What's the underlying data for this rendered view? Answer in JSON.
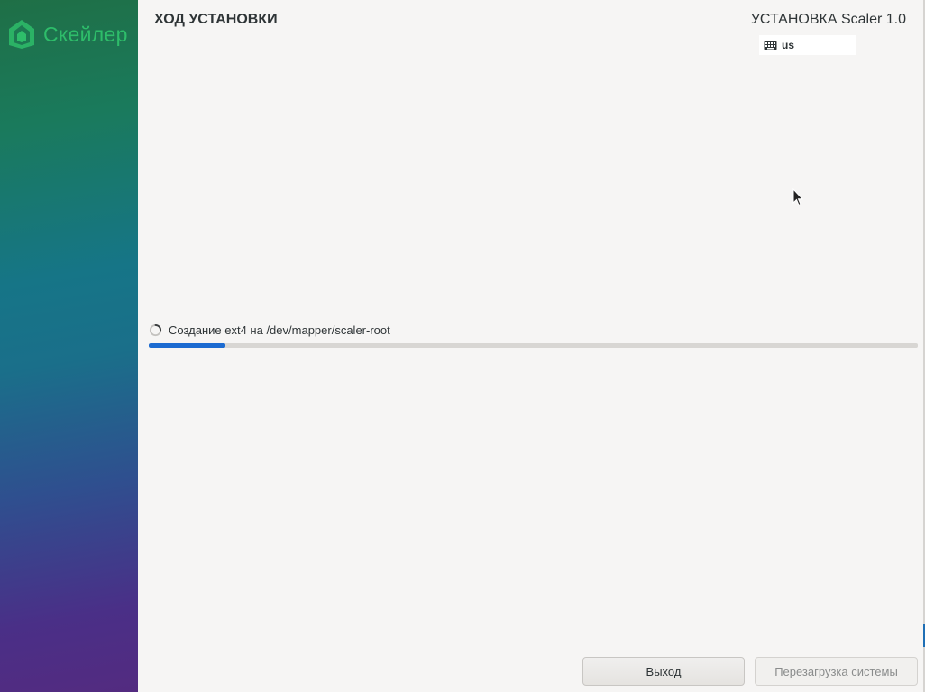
{
  "sidebar": {
    "brand_name": "Скейлер",
    "brand_color": "#2ebd6a"
  },
  "header": {
    "page_title": "ХОД УСТАНОВКИ",
    "product_title": "УСТАНОВКА Scaler 1.0",
    "keyboard_layout": "us"
  },
  "progress": {
    "status_text": "Создание ext4 на /dev/mapper/scaler-root",
    "fraction": 0.1,
    "accent_color": "#1c6bd1"
  },
  "buttons": {
    "quit_label": "Выход",
    "reboot_label": "Перезагрузка системы",
    "reboot_enabled": false
  },
  "icons": {
    "brand": "scaler-logo-icon",
    "keyboard": "keyboard-icon",
    "spinner": "spinner-icon",
    "cursor": "mouse-cursor-icon"
  }
}
